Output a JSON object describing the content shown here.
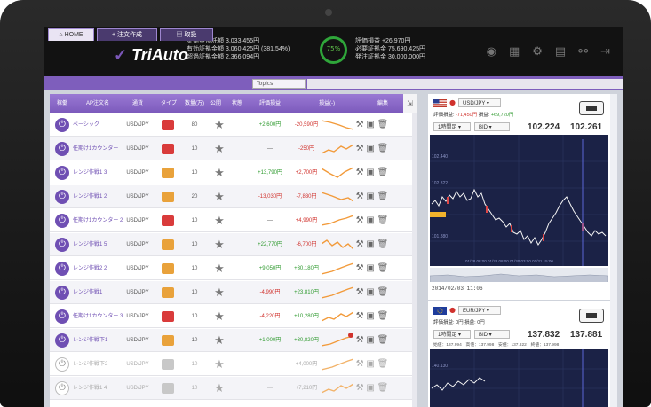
{
  "app": {
    "title": "TriAuto"
  },
  "header": {
    "account_lines": [
      "証拠金預託額 3,033,455円",
      "有効証拠金額 3,060,425円 (381.54%)",
      "超過証拠金額 2,366,094円"
    ],
    "gauge_label": "75%",
    "pnl_lines": [
      "評価損益 +26,970円",
      "必要証拠金 75,690,425円",
      "発注証拠金 30,000,000円"
    ],
    "icons": [
      "robot-icon",
      "grid-icon",
      "gear-icon",
      "document-icon",
      "link-icon",
      "logout-icon"
    ],
    "accent_color": "#2fa63a"
  },
  "tabs": [
    {
      "label": "HOME",
      "active": true
    },
    {
      "label": "+ 注文作成",
      "active": false
    },
    {
      "label": "取扱",
      "active": false
    }
  ],
  "topics": {
    "label": "Topics"
  },
  "table": {
    "headers": [
      "稼働",
      "AP注文名",
      "通貨",
      "タイプ",
      "数量(万)",
      "公開",
      "状態",
      "評価損益",
      "損益(-)",
      "編集"
    ],
    "rows": [
      {
        "name": "ベーシック",
        "pair": "USD/JPY",
        "type": "down",
        "qty": "80",
        "pnl": "+2,600円",
        "pnl_class": "pos",
        "total": "-20,590円",
        "total_class": "neg",
        "on": true,
        "spark": "flatdown"
      },
      {
        "name": "任期け1カウンター",
        "pair": "USD/JPY",
        "type": "down",
        "qty": "10",
        "pnl": "—",
        "pnl_class": "",
        "total": "-250円",
        "total_class": "neg",
        "on": true,
        "spark": "wave"
      },
      {
        "name": "レンジ作戦1 3",
        "pair": "USD/JPY",
        "type": "ud",
        "qty": "10",
        "pnl": "+13,790円",
        "pnl_class": "pos",
        "total": "+2,700円",
        "total_class": "neg",
        "on": true,
        "spark": "vee"
      },
      {
        "name": "レンジ作戦1 2",
        "pair": "USD/JPY",
        "type": "ud",
        "qty": "20",
        "pnl": "-13,030円",
        "pnl_class": "neg",
        "total": "-7,830円",
        "total_class": "neg",
        "on": true,
        "spark": "down"
      },
      {
        "name": "任期け1カウンター 2",
        "pair": "USD/JPY",
        "type": "down",
        "qty": "10",
        "pnl": "—",
        "pnl_class": "",
        "total": "+4,990円",
        "total_class": "neg",
        "on": true,
        "spark": "up"
      },
      {
        "name": "レンジ作戦1 5",
        "pair": "USD/JPY",
        "type": "ud",
        "qty": "10",
        "pnl": "+22,770円",
        "pnl_class": "pos",
        "total": "-6,700円",
        "total_class": "neg",
        "on": true,
        "spark": "zigzag"
      },
      {
        "name": "レンジ作戦2 2",
        "pair": "USD/JPY",
        "type": "ud",
        "qty": "10",
        "pnl": "+9,050円",
        "pnl_class": "pos",
        "total": "+30,180円",
        "total_class": "pos",
        "on": true,
        "spark": "upsmooth"
      },
      {
        "name": "レンジ作戦1",
        "pair": "USD/JPY",
        "type": "ud",
        "qty": "10",
        "pnl": "-4,990円",
        "pnl_class": "neg",
        "total": "+23,810円",
        "total_class": "pos",
        "on": true,
        "spark": "upsmooth"
      },
      {
        "name": "任期け1カウンター 3",
        "pair": "USD/JPY",
        "type": "down",
        "qty": "10",
        "pnl": "-4,220円",
        "pnl_class": "neg",
        "total": "+10,280円",
        "total_class": "pos",
        "on": true,
        "spark": "wave"
      },
      {
        "name": "レンジ作戦下1",
        "pair": "USD/JPY",
        "type": "ud",
        "qty": "10",
        "pnl": "+1,000円",
        "pnl_class": "pos",
        "total": "+30,820円",
        "total_class": "pos",
        "on": true,
        "spark": "upbadge"
      },
      {
        "name": "レンジ作戦下2",
        "pair": "USD/JPY",
        "type": "grey",
        "qty": "10",
        "pnl": "—",
        "pnl_class": "",
        "total": "+4,000円",
        "total_class": "",
        "on": false,
        "spark": "upsmooth"
      },
      {
        "name": "レンジ作戦1 4",
        "pair": "USD/JPY",
        "type": "grey",
        "qty": "10",
        "pnl": "—",
        "pnl_class": "",
        "total": "+7,210円",
        "total_class": "",
        "on": false,
        "spark": "wave"
      }
    ]
  },
  "rate_panels": [
    {
      "pair": "USD/JPY",
      "pnl_label": "評価損益:",
      "pnl_value": "-71,450円",
      "loss_label": "損益:",
      "loss_value": "+69,720円",
      "mode": "1時間足",
      "side": "BID",
      "bid": "102.224",
      "ask": "102.261",
      "time": "2014/02/03 11:06"
    },
    {
      "pair": "EUR/JPY",
      "pnl_label": "評価損益:",
      "pnl_value": "0円",
      "loss_label": "損益:",
      "loss_value": "0円",
      "mode": "1時間足",
      "side": "BID",
      "bid": "137.832",
      "ask": "137.881",
      "stats": "始値：137.994　高値：137.998　安値：137.822　終値：137.998"
    }
  ]
}
